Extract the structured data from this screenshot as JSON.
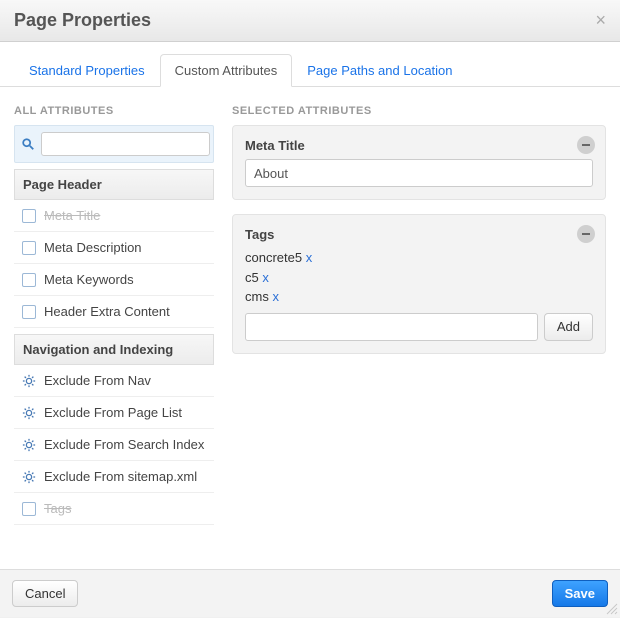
{
  "dialog": {
    "title": "Page Properties",
    "close_label": "×"
  },
  "tabs": [
    {
      "id": "standard",
      "label": "Standard Properties",
      "active": false
    },
    {
      "id": "custom",
      "label": "Custom Attributes",
      "active": true
    },
    {
      "id": "paths",
      "label": "Page Paths and Location",
      "active": false
    }
  ],
  "left": {
    "heading": "ALL ATTRIBUTES",
    "search_value": "",
    "groups": [
      {
        "name": "Page Header",
        "items": [
          {
            "label": "Meta Title",
            "disabled": true,
            "icon": "text"
          },
          {
            "label": "Meta Description",
            "disabled": false,
            "icon": "text"
          },
          {
            "label": "Meta Keywords",
            "disabled": false,
            "icon": "text"
          },
          {
            "label": "Header Extra Content",
            "disabled": false,
            "icon": "text"
          }
        ]
      },
      {
        "name": "Navigation and Indexing",
        "items": [
          {
            "label": "Exclude From Nav",
            "disabled": false,
            "icon": "gear"
          },
          {
            "label": "Exclude From Page List",
            "disabled": false,
            "icon": "gear"
          },
          {
            "label": "Exclude From Search Index",
            "disabled": false,
            "icon": "gear"
          },
          {
            "label": "Exclude From sitemap.xml",
            "disabled": false,
            "icon": "gear"
          },
          {
            "label": "Tags",
            "disabled": true,
            "icon": "text"
          }
        ]
      }
    ]
  },
  "right": {
    "heading": "SELECTED ATTRIBUTES",
    "panels": {
      "meta_title": {
        "title": "Meta Title",
        "value": "About"
      },
      "tags": {
        "title": "Tags",
        "tags": [
          "concrete5",
          "c5",
          "cms"
        ],
        "remove_glyph": "x",
        "add_value": "",
        "add_button": "Add"
      }
    }
  },
  "footer": {
    "cancel": "Cancel",
    "save": "Save"
  }
}
